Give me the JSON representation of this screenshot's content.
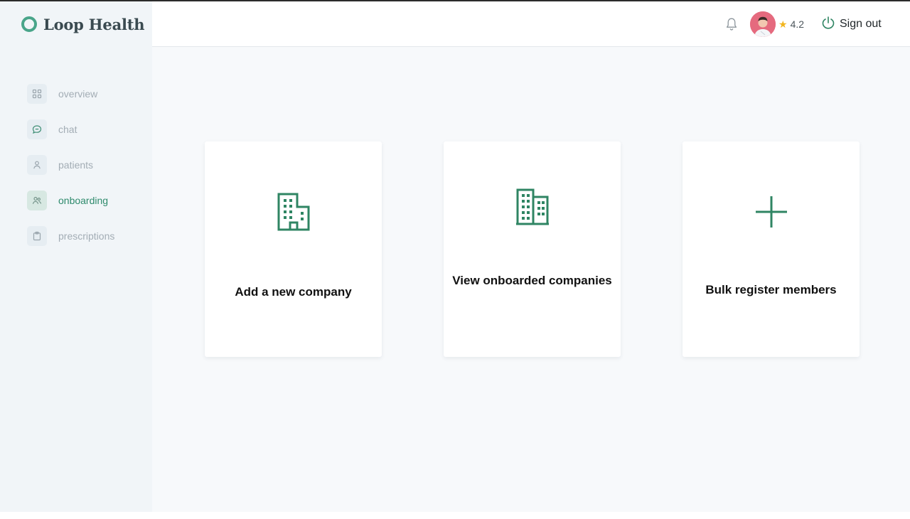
{
  "brand": {
    "name": "Loop Health",
    "accent": "#49a58a"
  },
  "sidebar": {
    "items": [
      {
        "label": "overview",
        "icon": "grid-icon",
        "active": false
      },
      {
        "label": "chat",
        "icon": "chat-bubble-icon",
        "active": false
      },
      {
        "label": "patients",
        "icon": "user-icon",
        "active": false
      },
      {
        "label": "onboarding",
        "icon": "users-icon",
        "active": true
      },
      {
        "label": "prescriptions",
        "icon": "clipboard-icon",
        "active": false
      }
    ]
  },
  "header": {
    "notifications_icon": "bell-icon",
    "avatar_icon": "avatar",
    "rating": "4.2",
    "rating_icon": "star-icon",
    "signout_label": "Sign out",
    "signout_icon": "power-icon"
  },
  "cards": [
    {
      "label": "Add a new company",
      "icon": "building-icon"
    },
    {
      "label": "View onboarded companies",
      "icon": "buildings-icon"
    },
    {
      "label": "Bulk register members",
      "icon": "plus-icon"
    }
  ],
  "colors": {
    "accent_green": "#2e8a6c",
    "icon_green": "#2f8563",
    "star": "#f2b51d",
    "sidebar_bg": "#f1f5f8"
  }
}
